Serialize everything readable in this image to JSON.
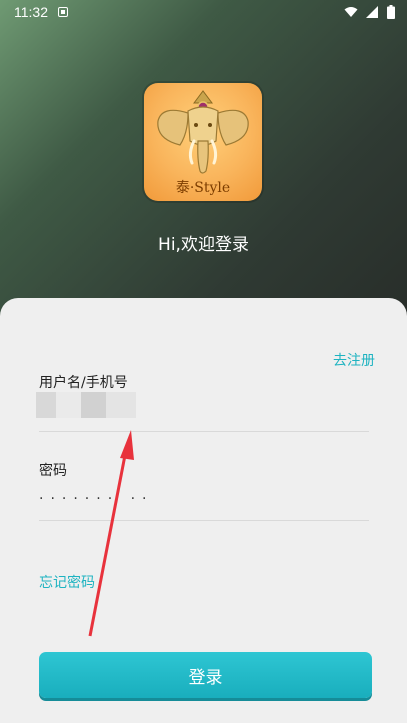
{
  "status_bar": {
    "time": "11:32",
    "icons": [
      "notification-icon",
      "wifi-icon",
      "signal-icon",
      "battery-icon"
    ]
  },
  "logo": {
    "text": "泰·Style",
    "icon": "elephant-icon"
  },
  "welcome": "Hi,欢迎登录",
  "form": {
    "register_label": "去注册",
    "username_label": "用户名/手机号",
    "password_label": "密码",
    "password_value": "·······  ··",
    "forgot_label": "忘记密码",
    "login_label": "登录"
  },
  "colors": {
    "accent": "#1eb3c1",
    "button": "#19aebd",
    "annotation_arrow": "#e8323c"
  }
}
